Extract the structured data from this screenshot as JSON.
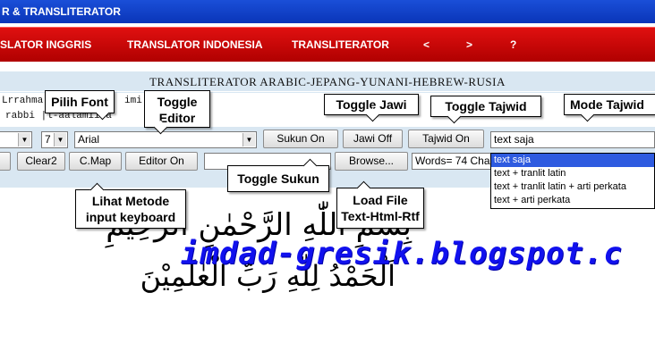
{
  "window": {
    "title": "R & TRANSLITERATOR"
  },
  "menu": {
    "items": [
      {
        "label": "SLATOR INGGRIS"
      },
      {
        "label": "TRANSLATOR INDONESIA"
      },
      {
        "label": "TRANSLITERATOR"
      },
      {
        "label": "<"
      },
      {
        "label": ">"
      },
      {
        "label": "?"
      }
    ]
  },
  "app": {
    "title": "TRANSLITERATOR ARABIC-JEPANG-YUNANI-HEBREW-RUSIA",
    "translit_line1": "Lrrahma",
    "translit_line1b": "imi",
    "translit_line2": "rabbi |l-aalamiina"
  },
  "toolbar1": {
    "size_value": "7",
    "font_value": "Arial",
    "sukun_label": "Sukun On",
    "jawi_label": "Jawi Off",
    "tajwid_label": "Tajwid On",
    "mode_value": "text saja"
  },
  "toolbar2": {
    "clear2_label": "Clear2",
    "cmap_label": "C.Map",
    "editor_label": "Editor On",
    "browse_label": "Browse...",
    "words_label": "Words= 74 Cha"
  },
  "dropdown": {
    "options": [
      "text saja",
      "text + tranlit latin",
      "text + tranlit latin + arti perkata",
      "text + arti perkata"
    ]
  },
  "callouts": {
    "pilih_font": "Pilih Font",
    "toggle_editor_1": "Toggle",
    "toggle_editor_2": "Editor",
    "toggle_jawi": "Toggle Jawi",
    "toggle_tajwid": "Toggle Tajwid",
    "mode_tajwid": "Mode Tajwid",
    "lihat_1": "Lihat Metode",
    "lihat_2": "input keyboard",
    "toggle_sukun": "Toggle Sukun",
    "load_1": "Load File",
    "load_2": "Text-Html-Rtf"
  },
  "content": {
    "arabic_line1": "بِسْمِ اللّٰهِ الرَّحْمٰنِ الرَّحِيْمِ",
    "arabic_line2": "اَلْحَمْدُ لِلّٰهِ رَبِّ الْعٰلَمِيْنَ",
    "watermark": "imdad-gresik.blogspot.c"
  },
  "colors": {
    "titlebar": "#0a35b8",
    "menubar": "#c00000",
    "app_bg": "#d9e7f2",
    "watermark": "#1111ee"
  }
}
